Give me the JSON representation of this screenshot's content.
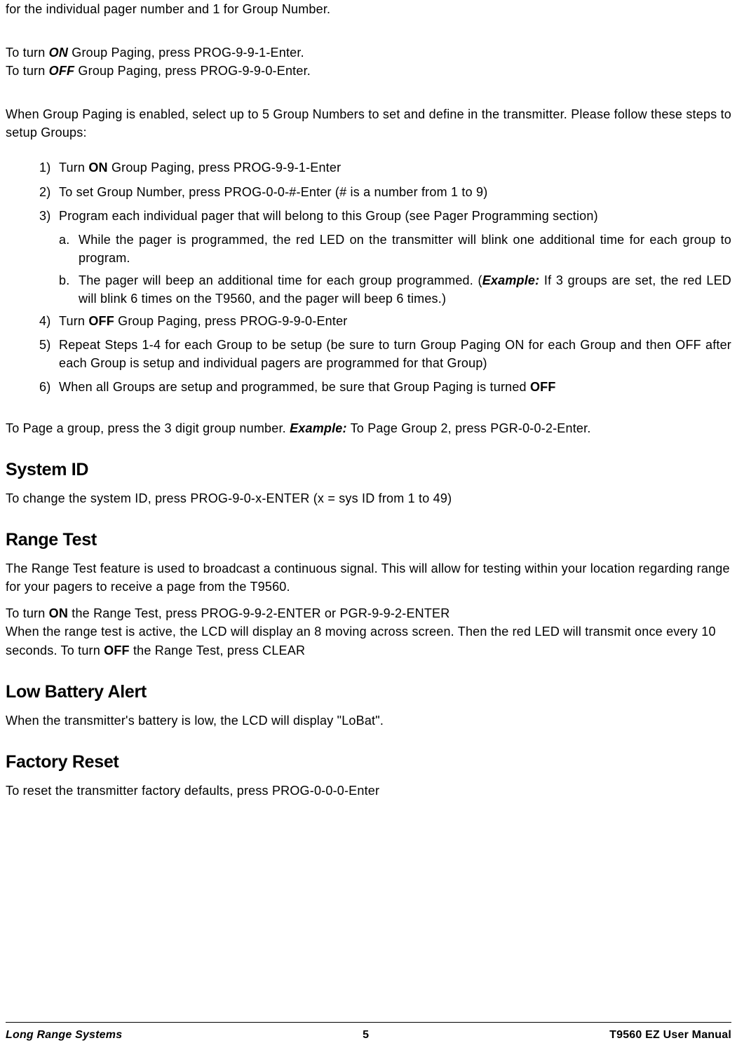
{
  "intro": {
    "line1": "for the individual pager number and 1 for Group Number."
  },
  "turn": {
    "on_prefix": "To turn ",
    "on_bold": "ON",
    "on_suffix": " Group Paging, press PROG-9-9-1-Enter.",
    "off_prefix": "To turn ",
    "off_bold": "OFF",
    "off_suffix": " Group Paging, press PROG-9-9-0-Enter."
  },
  "enabled_text": "When Group Paging is enabled, select up to 5 Group Numbers to set and define in the transmitter. Please follow these steps to setup Groups:",
  "steps": {
    "s1": {
      "num": "1)",
      "prefix": "Turn ",
      "bold": "ON",
      "suffix": " Group Paging, press PROG-9-9-1-Enter"
    },
    "s2": {
      "num": "2)",
      "text": "To set Group Number, press PROG-0-0-#-Enter (# is a number from 1 to 9)"
    },
    "s3": {
      "num": "3)",
      "text": "Program each individual pager that will belong to this Group (see Pager Programming section)"
    },
    "s3a": {
      "num": "a.",
      "text": "While the pager is programmed, the red LED on the transmitter will blink one additional time for each group to program."
    },
    "s3b": {
      "num": "b.",
      "prefix": "The pager will beep an additional time for each group programmed. (",
      "example_label": "Example:",
      "suffix": " If 3 groups are set, the red LED will blink 6 times on the T9560, and the pager will beep 6 times.)"
    },
    "s4": {
      "num": "4)",
      "prefix": "Turn ",
      "bold": "OFF",
      "suffix": " Group Paging, press PROG-9-9-0-Enter"
    },
    "s5": {
      "num": "5)",
      "text": "Repeat Steps 1-4 for each Group to be setup (be sure to turn Group Paging ON for each Group and then OFF after each Group is setup and individual pagers are programmed for that Group)"
    },
    "s6": {
      "num": "6)",
      "prefix": "When all Groups are setup and programmed, be sure that Group Paging is turned ",
      "bold": "OFF"
    }
  },
  "page_group": {
    "prefix": "To Page a group, press the 3 digit group number. ",
    "example_label": "Example:",
    "suffix": " To Page Group 2, press PGR-0-0-2-Enter."
  },
  "sections": {
    "system_id": {
      "heading": "System ID",
      "body": "To change the system ID, press PROG-9-0-x-ENTER (x = sys ID from 1 to 49)"
    },
    "range_test": {
      "heading": "Range Test",
      "p1": "The Range Test feature is used to broadcast a continuous signal. This will allow for testing within your location regarding range for your pagers to receive a page from the T9560.",
      "p2_prefix": "To turn ",
      "p2_bold1": "ON",
      "p2_mid": " the Range Test, press PROG-9-9-2-ENTER or PGR-9-9-2-ENTER",
      "p3_prefix": "When the range test is active, the LCD will display an 8 moving across screen. Then the red LED will transmit once every 10 seconds.  To turn ",
      "p3_bold": "OFF",
      "p3_suffix": " the Range Test, press CLEAR"
    },
    "low_battery": {
      "heading": "Low Battery Alert",
      "body": "When the transmitter's battery is low, the LCD will display \"LoBat\"."
    },
    "factory_reset": {
      "heading": "Factory Reset",
      "body": "To reset the transmitter factory defaults, press PROG-0-0-0-Enter"
    }
  },
  "footer": {
    "left": "Long Range Systems",
    "center": "5",
    "right": "T9560 EZ User Manual"
  }
}
